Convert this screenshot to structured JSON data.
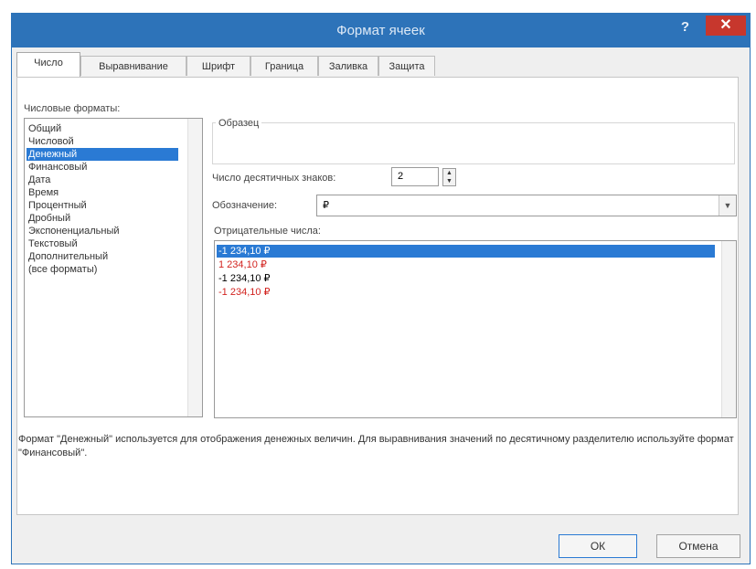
{
  "window": {
    "title": "Формат ячеек",
    "help": "?",
    "close": "✕"
  },
  "tabs": [
    {
      "label": "Число",
      "active": true
    },
    {
      "label": "Выравнивание"
    },
    {
      "label": "Шрифт"
    },
    {
      "label": "Граница"
    },
    {
      "label": "Заливка"
    },
    {
      "label": "Защита"
    }
  ],
  "number_formats": {
    "label": "Числовые форматы:",
    "items": [
      "Общий",
      "Числовой",
      "Денежный",
      "Финансовый",
      "Дата",
      "Время",
      "Процентный",
      "Дробный",
      "Экспоненциальный",
      "Текстовый",
      "Дополнительный",
      "(все форматы)"
    ],
    "selected_index": 2
  },
  "sample": {
    "label": "Образец",
    "value": ""
  },
  "decimal_places": {
    "label": "Число десятичных знаков:",
    "value": "2"
  },
  "symbol": {
    "label": "Обозначение:",
    "value": "₽"
  },
  "negative_numbers": {
    "label": "Отрицательные числа:",
    "items": [
      {
        "text": "-1 234,10 ₽",
        "color": "black",
        "selected": true
      },
      {
        "text": "1 234,10 ₽",
        "color": "red"
      },
      {
        "text": "-1 234,10 ₽",
        "color": "black"
      },
      {
        "text": "-1 234,10 ₽",
        "color": "red"
      }
    ]
  },
  "description": "Формат \"Денежный\" используется для отображения денежных величин. Для выравнивания значений по десятичному разделителю используйте формат \"Финансовый\".",
  "buttons": {
    "ok": "ОК",
    "cancel": "Отмена"
  },
  "colors": {
    "titlebar": "#2d73b9",
    "selection": "#2a7ad4",
    "negative_red": "#d2231f",
    "close_button": "#c7372d"
  }
}
